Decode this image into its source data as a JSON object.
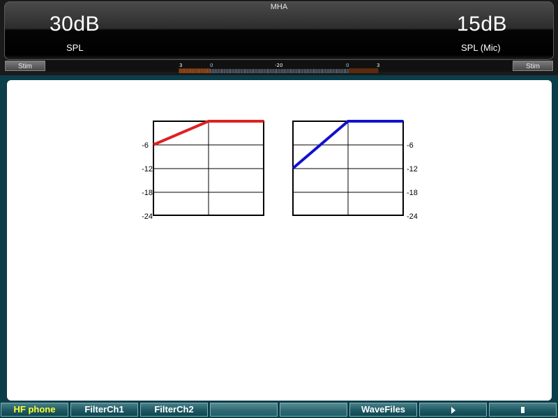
{
  "header": {
    "title": "MHA",
    "left_level": "30dB",
    "left_unit": "SPL",
    "right_level": "15dB",
    "right_unit": "SPL (Mic)",
    "stim_left": "Stim",
    "stim_right": "Stim"
  },
  "meter": {
    "labels": [
      "3",
      "0",
      "-20",
      "0",
      "3"
    ]
  },
  "graphs": {
    "ytick_labels": [
      "-6",
      "-12",
      "-18",
      "-24"
    ]
  },
  "chart_data": [
    {
      "type": "line",
      "series": [
        {
          "color": "#e02020",
          "x": [
            0,
            1,
            2
          ],
          "y": [
            -6,
            0,
            0
          ]
        }
      ],
      "yticks": [
        -6,
        -12,
        -18,
        -24
      ],
      "ylim": [
        -24,
        0
      ],
      "xlim": [
        0,
        2
      ],
      "grid": true,
      "ytick_side": "left"
    },
    {
      "type": "line",
      "series": [
        {
          "color": "#1010d0",
          "x": [
            0,
            1,
            2
          ],
          "y": [
            -12,
            0,
            0
          ]
        }
      ],
      "yticks": [
        -6,
        -12,
        -18,
        -24
      ],
      "ylim": [
        -24,
        0
      ],
      "xlim": [
        0,
        2
      ],
      "grid": true,
      "ytick_side": "right"
    }
  ],
  "function_keys": [
    {
      "label": "HF phone",
      "active": true
    },
    {
      "label": "FilterCh1",
      "active": false
    },
    {
      "label": "FilterCh2",
      "active": false
    },
    {
      "label": "",
      "active": false
    },
    {
      "label": "",
      "active": false
    },
    {
      "label": "WaveFiles",
      "active": false
    },
    {
      "label": "",
      "icon": "play-icon",
      "active": false
    },
    {
      "label": "",
      "icon": "stop-icon",
      "active": false
    }
  ]
}
